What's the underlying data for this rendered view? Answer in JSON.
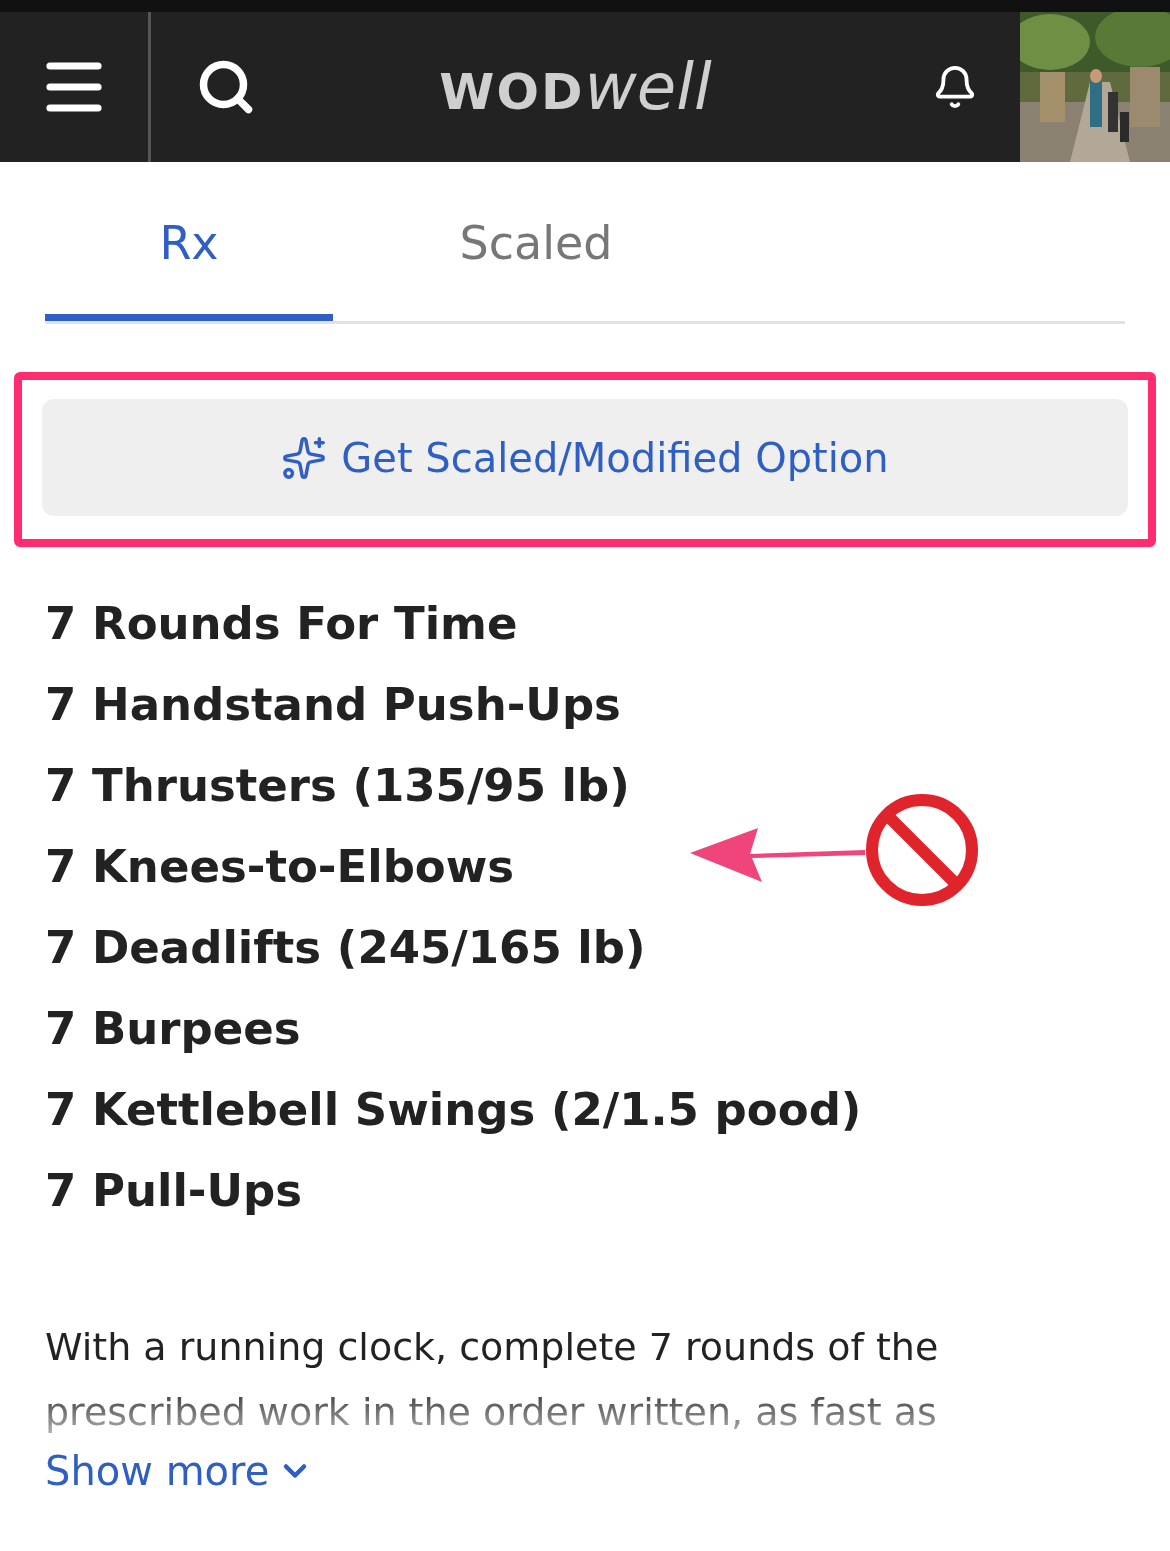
{
  "header": {
    "logo_bold": "WOD",
    "logo_light": "well"
  },
  "tabs": [
    {
      "label": "Rx",
      "selected": true
    },
    {
      "label": "Scaled",
      "selected": false
    }
  ],
  "scale_button": {
    "label": "Get Scaled/Modified Option"
  },
  "workout": [
    "7 Rounds For Time",
    "7 Handstand Push-Ups",
    "7 Thrusters (135/95 lb)",
    "7 Knees-to-Elbows",
    "7 Deadlifts (245/165 lb)",
    "7 Burpees",
    "7 Kettlebell Swings (2/1.5 pood)",
    "7 Pull-Ups"
  ],
  "description": "With a running clock, complete 7 rounds of the prescribed work in the order written, as fast as",
  "show_more": "Show more"
}
